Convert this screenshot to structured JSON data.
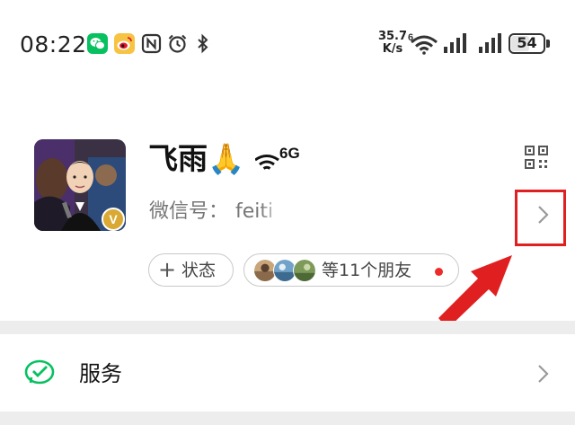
{
  "status_bar": {
    "time": "08:22",
    "icons": [
      "wechat-icon",
      "weibo-icon",
      "nfc-icon",
      "alarm-icon",
      "bluetooth-icon",
      "wifi-icon",
      "signal-icon",
      "signal-icon"
    ],
    "net_speed_value": "35.7",
    "net_speed_unit": "K/s",
    "wifi_generation": "6",
    "battery_level": "54",
    "battery_percent": 54
  },
  "profile": {
    "nickname": "飞雨🙏",
    "nickname_suffix_icon": "wifi-6g-icon",
    "nickname_suffix": "6G",
    "wechat_id_label": "微信号：",
    "wechat_id_value": "feiti",
    "avatar_badge": "V",
    "qr_icon": "qr-code-icon",
    "status_button": {
      "icon": "+",
      "label": "状态"
    },
    "friends_button": {
      "label": "等11个朋友",
      "has_red_dot": true
    }
  },
  "menu": {
    "services": {
      "label": "服务",
      "icon": "wechat-pay-icon"
    }
  },
  "colors": {
    "accent_green": "#07c160",
    "annotation_red": "#e02020",
    "divider": "#ededed",
    "badge_gold": "#d9a934"
  }
}
